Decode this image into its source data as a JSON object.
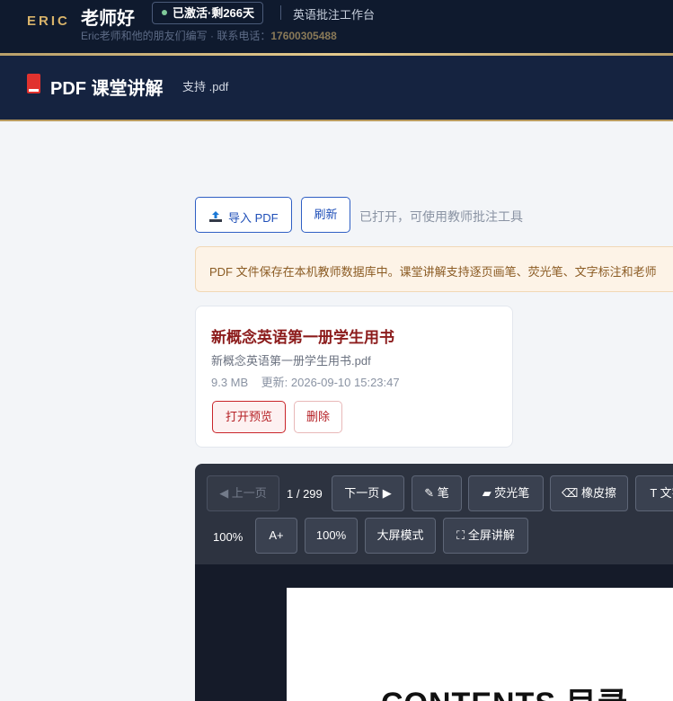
{
  "app": {
    "logo": "ERIC",
    "greeting": "老师好",
    "license_badge": "已激活·剩266天",
    "workbench_title": "英语批注工作台",
    "contact_prefix": "Eric老师和他的朋友们编写 · 联系电话：",
    "contact_phone": "17600305488"
  },
  "header": {
    "title": "PDF 课堂讲解",
    "subtitle": "支持 .pdf",
    "icon": "book-icon"
  },
  "actions": {
    "import_label": "导入 PDF",
    "refresh_label": "刷新",
    "status_text": "已打开，可使用教师批注工具"
  },
  "notice": "PDF 文件保存在本机教师数据库中。课堂讲解支持逐页画笔、荧光笔、文字标注和老师",
  "document": {
    "title": "新概念英语第一册学生用书",
    "filename": "新概念英语第一册学生用书.pdf",
    "size": "9.3 MB",
    "updated_label": "更新:",
    "updated": "2026-09-10 15:23:47",
    "open_label": "打开预览",
    "delete_label": "删除"
  },
  "viewer": {
    "prev_label": "◀ 上一页",
    "page_indicator": "1 / 299",
    "next_label": "下一页 ▶",
    "pen_label": "✎ 笔",
    "highlighter_label": "▰ 荧光笔",
    "eraser_label": "⌫ 橡皮擦",
    "text_label": "T 文字",
    "zoom_display": "100%",
    "zoom_in_label": "A+",
    "zoom_reset_label": "100%",
    "big_screen_label": "大屏模式",
    "fullscreen_label": "⛶ 全屏讲解",
    "page_heading": "CONTENTS 目录"
  },
  "colors": {
    "nav_bg": "#0f1a2e",
    "accent_gold": "#d8b36a",
    "primary_blue": "#1f4fb8",
    "danger_red": "#b51f24"
  }
}
